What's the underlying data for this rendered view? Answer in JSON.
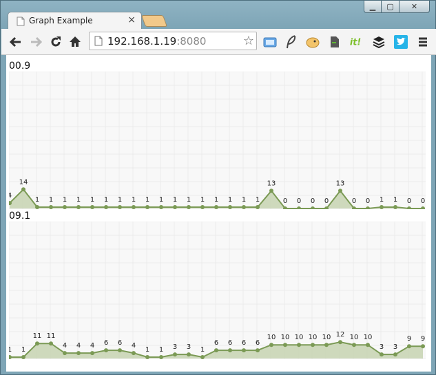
{
  "browser": {
    "tab_title": "Graph Example",
    "tab_close": "×",
    "url_host": "192.168.1.19",
    "url_port": ":8080",
    "star": "☆",
    "win_min": "▁",
    "win_max": "▢",
    "win_close": "✕",
    "extensions": [
      "pocket-icon",
      "feather-icon",
      "puffer-icon",
      "evernote-icon",
      "scoopit-icon",
      "buffer-icon",
      "twitter-icon",
      "menu-icon"
    ]
  },
  "graphs": [
    {
      "title": "00.9",
      "chart_data": {
        "type": "area",
        "values": [
          4,
          14,
          1,
          1,
          1,
          1,
          1,
          1,
          1,
          1,
          1,
          1,
          1,
          1,
          1,
          1,
          1,
          1,
          1,
          13,
          0,
          0,
          0,
          0,
          13,
          0,
          0,
          1,
          1,
          0,
          0
        ],
        "labels": [
          "4",
          "14",
          "1",
          "1",
          "1",
          "1",
          "1",
          "1",
          "1",
          "1",
          "1",
          "1",
          "1",
          "1",
          "1",
          "1",
          "1",
          "1",
          "1",
          "13",
          "0",
          "0",
          "0",
          "0",
          "13",
          "0",
          "0",
          "1",
          "1",
          "0",
          "0"
        ],
        "ylim": [
          0,
          100
        ],
        "grid": true,
        "line_color": "#7b9a55",
        "fill_color": "#c7d4b2"
      }
    },
    {
      "title": "09.1",
      "chart_data": {
        "type": "area",
        "values": [
          1,
          1,
          11,
          11,
          4,
          4,
          4,
          6,
          6,
          4,
          1,
          1,
          3,
          3,
          1,
          6,
          6,
          6,
          6,
          10,
          10,
          10,
          10,
          10,
          12,
          10,
          10,
          3,
          3,
          9,
          9
        ],
        "labels": [
          "1",
          "1",
          "11",
          "11",
          "4",
          "4",
          "4",
          "6",
          "6",
          "4",
          "1",
          "1",
          "3",
          "3",
          "1",
          "6",
          "6",
          "6",
          "6",
          "10",
          "10",
          "10",
          "10",
          "10",
          "12",
          "10",
          "10",
          "3",
          "3",
          "9",
          "9"
        ],
        "ylim": [
          0,
          100
        ],
        "grid": true,
        "line_color": "#7b9a55",
        "fill_color": "#c7d4b2"
      }
    }
  ]
}
